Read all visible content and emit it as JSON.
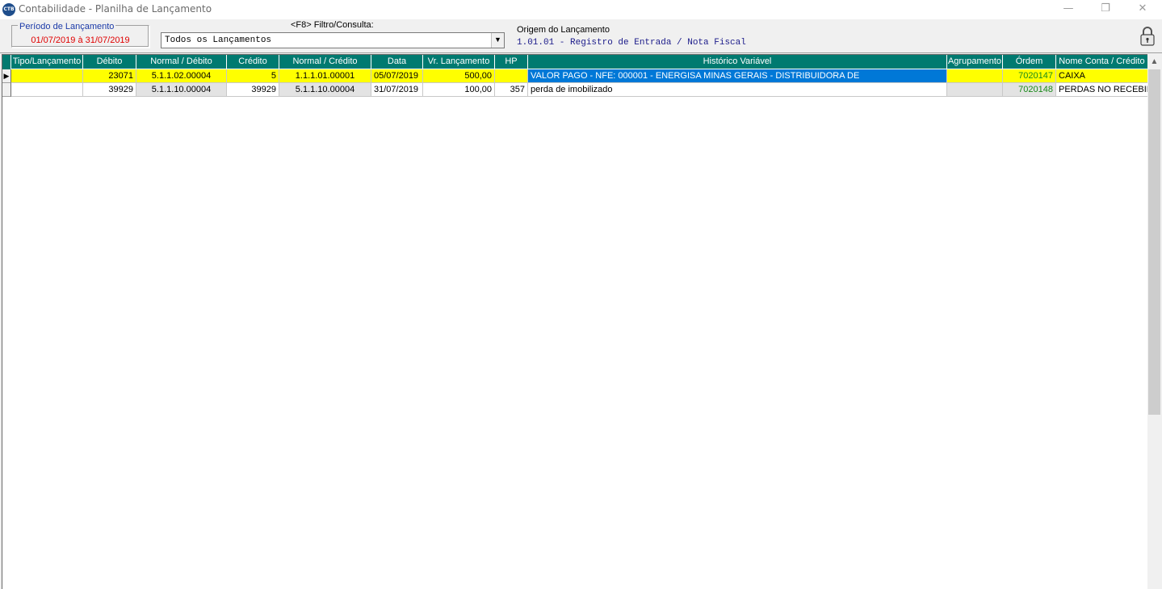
{
  "window": {
    "title": "Contabilidade - Planilha de Lançamento",
    "app_icon_text": "CTB",
    "controls": {
      "minimize": "—",
      "restore": "❐",
      "close": "✕"
    }
  },
  "period": {
    "legend": "Período de Lançamento",
    "value": "01/07/2019 à 31/07/2019",
    "value_color": "#e00000"
  },
  "filter": {
    "label": "<F8> Filtro/Consulta:",
    "value": "Todos os Lançamentos"
  },
  "origin": {
    "label": "Origem do Lançamento",
    "value": "1.01.01 - Registro de Entrada / Nota Fiscal"
  },
  "lock_icon": "lock-icon",
  "grid": {
    "header_color": "#007a70",
    "columns": [
      "Tipo/Lançamento",
      "Débito",
      "Normal / Débito",
      "Crédito",
      "Normal / Crédito",
      "Data",
      "Vr. Lançamento",
      "HP",
      "Histórico Variável",
      "Agrupamento",
      "Órdem",
      "Nome Conta / Crédito"
    ],
    "rows": [
      {
        "selected": true,
        "indicator": "▶",
        "tipo": "",
        "debito": "23071",
        "normal_debito": "5.1.1.02.00004",
        "credito": "5",
        "normal_credito": "1.1.1.01.00001",
        "data": "05/07/2019",
        "valor": "500,00",
        "hp": "",
        "historico": "VALOR PAGO - NFE: 000001 - ENERGISA MINAS GERAIS - DISTRIBUIDORA DE",
        "agrupamento": "",
        "ordem": "7020147",
        "nome_conta": "CAIXA"
      },
      {
        "selected": false,
        "indicator": "",
        "tipo": "",
        "debito": "39929",
        "normal_debito": "5.1.1.10.00004",
        "credito": "39929",
        "normal_credito": "5.1.1.10.00004",
        "data": "31/07/2019",
        "valor": "100,00",
        "hp": "357",
        "historico": "perda de imobilizado",
        "agrupamento": "",
        "ordem": "7020148",
        "nome_conta": "PERDAS NO RECEBIME"
      }
    ]
  }
}
